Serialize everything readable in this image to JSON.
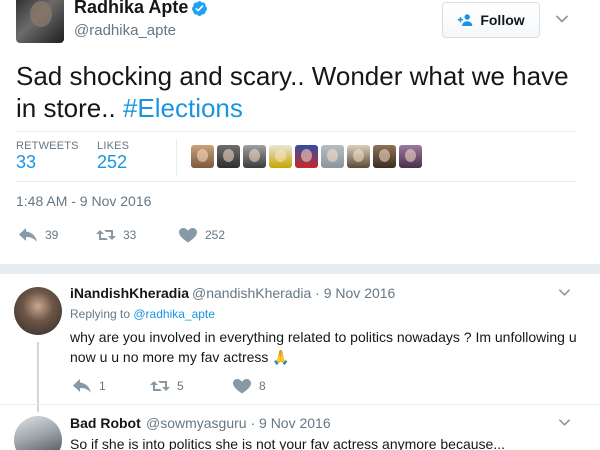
{
  "main_tweet": {
    "author_name": "Radhika Apte",
    "author_handle": "@radhika_apte",
    "verified": true,
    "follow_label": "Follow",
    "text_plain": "Sad shocking and scary.. Wonder what we have in store.. ",
    "hashtag": "#Elections",
    "stats": {
      "retweets_label": "RETWEETS",
      "retweets_value": "33",
      "likes_label": "LIKES",
      "likes_value": "252"
    },
    "liker_avatars_count": 9,
    "timestamp": "1:48 AM - 9 Nov 2016",
    "actions": {
      "replies": "39",
      "retweets": "33",
      "likes": "252"
    }
  },
  "replies": [
    {
      "name": "iNandishKheradia",
      "handle_and_date": "@nandishKheradia · 9 Nov 2016",
      "replying_prefix": "Replying to ",
      "replying_to": "@radhika_apte",
      "text": "why are you involved in everything related to politics nowadays ? Im unfollowing u now u u no more my fav actress 🙏",
      "actions": {
        "replies": "1",
        "retweets": "5",
        "likes": "8"
      }
    },
    {
      "name": "Bad Robot",
      "handle_and_date": "@sowmyasguru · 9 Nov 2016",
      "text": "So if she is into politics she is not your fav actress anymore because..."
    }
  ],
  "colors": {
    "accent": "#1b95e0",
    "muted": "#657786",
    "icon": "#8899a6",
    "divider": "#e6ecf0",
    "verified": "#1da1f2"
  },
  "icons": [
    "verified-badge-icon",
    "follow-person-plus-icon",
    "chevron-down-icon",
    "reply-icon",
    "retweet-icon",
    "heart-icon"
  ]
}
